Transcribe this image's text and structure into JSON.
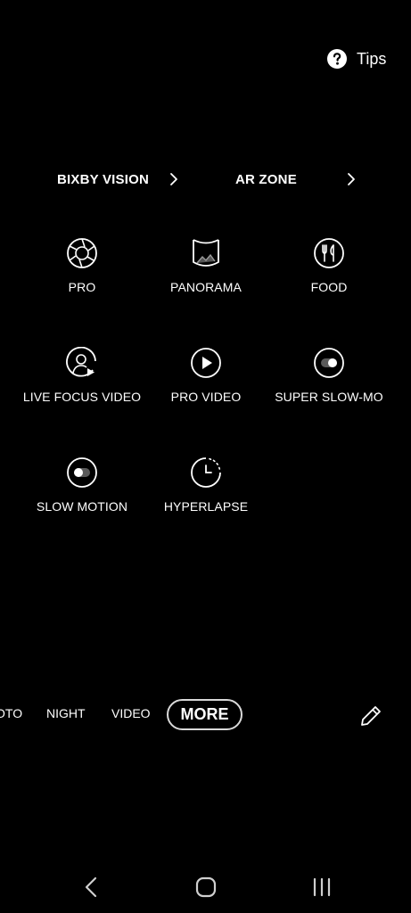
{
  "tips": {
    "label": "Tips",
    "icon": "question-circle-icon"
  },
  "shortcuts": [
    {
      "label": "BIXBY VISION",
      "icon": "chevron-right-icon"
    },
    {
      "label": "AR ZONE",
      "icon": "chevron-right-icon"
    }
  ],
  "modes": [
    {
      "label": "PRO",
      "icon": "aperture-icon"
    },
    {
      "label": "PANORAMA",
      "icon": "panorama-icon"
    },
    {
      "label": "FOOD",
      "icon": "fork-knife-icon"
    },
    {
      "label": "LIVE FOCUS VIDEO",
      "icon": "person-video-icon"
    },
    {
      "label": "PRO VIDEO",
      "icon": "play-circle-icon"
    },
    {
      "label": "SUPER SLOW-MO",
      "icon": "super-slow-mo-icon"
    },
    {
      "label": "SLOW MOTION",
      "icon": "slow-motion-icon"
    },
    {
      "label": "HYPERLAPSE",
      "icon": "timer-icon"
    }
  ],
  "mode_bar": {
    "items": [
      "OTO",
      "NIGHT",
      "VIDEO"
    ],
    "selected": "MORE",
    "edit_icon": "pencil-icon"
  },
  "nav": {
    "back_icon": "back-chevron-icon",
    "home_icon": "home-icon",
    "recents_icon": "recents-icon"
  }
}
